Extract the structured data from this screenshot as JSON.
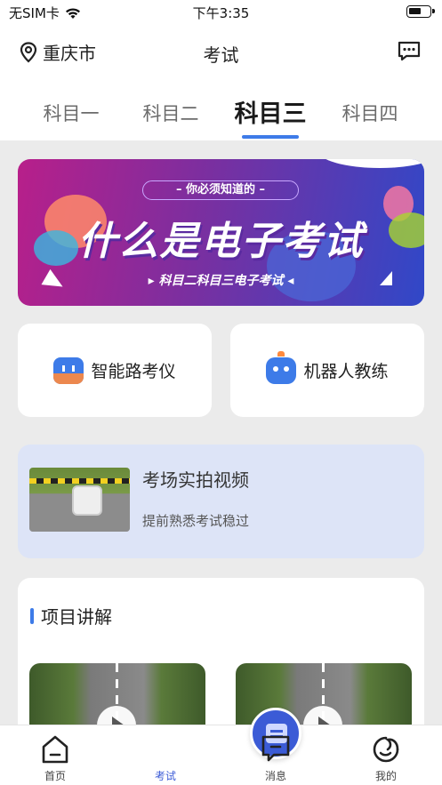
{
  "status_bar": {
    "carrier": "无SIM卡",
    "time": "下午3:35",
    "wifi_icon": "wifi-icon",
    "battery_icon": "battery-icon"
  },
  "header": {
    "location": "重庆市",
    "location_icon": "location-pin-icon",
    "title": "考试",
    "message_icon": "message-icon"
  },
  "tabs": [
    {
      "label": "科目一",
      "active": false
    },
    {
      "label": "科目二",
      "active": false
    },
    {
      "label": "科目三",
      "active": true
    },
    {
      "label": "科目四",
      "active": false
    }
  ],
  "banner": {
    "pill_text": "你必须知道的",
    "main_text": "什么是电子考试",
    "sub_text": "科目二科目三电子考试"
  },
  "tools": [
    {
      "label": "智能路考仪",
      "icon": "road-test-meter-icon"
    },
    {
      "label": "机器人教练",
      "icon": "robot-coach-icon"
    }
  ],
  "video_card": {
    "title": "考场实拍视频",
    "subtitle": "提前熟悉考试稳过"
  },
  "projects": {
    "heading": "项目讲解"
  },
  "tabbar": [
    {
      "label": "首页",
      "icon": "home-icon",
      "active": false
    },
    {
      "label": "考试",
      "icon": "exam-icon",
      "active": true
    },
    {
      "label": "消息",
      "icon": "message-icon",
      "active": false
    },
    {
      "label": "我的",
      "icon": "profile-icon",
      "active": false
    }
  ],
  "colors": {
    "accent": "#3d7be8",
    "tab_center": "#3b5bd6"
  }
}
